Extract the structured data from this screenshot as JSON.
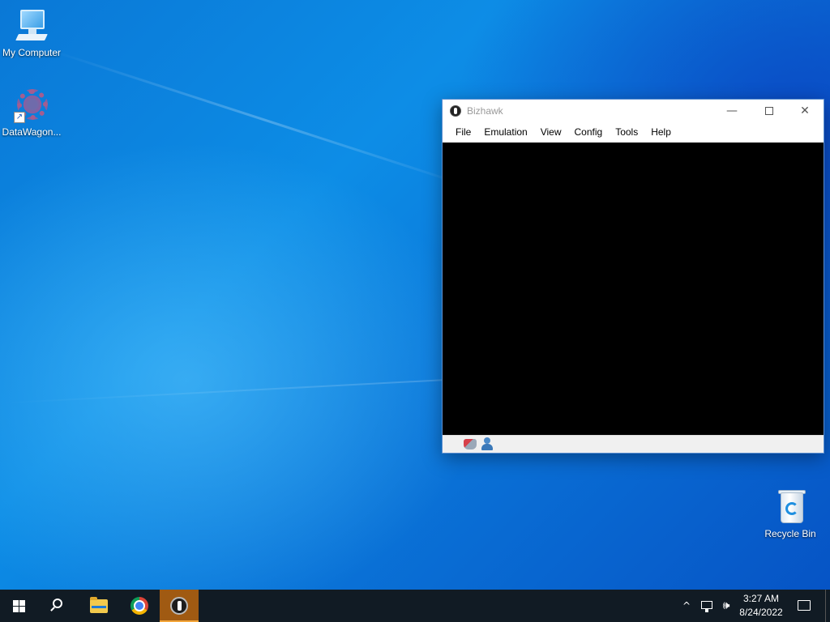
{
  "desktop": {
    "icons": [
      {
        "label": "My Computer",
        "icon": "computer-icon"
      },
      {
        "label": "DataWagon...",
        "icon": "datawagon-icon"
      },
      {
        "label": "Recycle Bin",
        "icon": "recycle-bin-icon"
      }
    ]
  },
  "window": {
    "title": "Bizhawk",
    "controls": {
      "minimize": "—",
      "close": "✕"
    },
    "menu": [
      "File",
      "Emulation",
      "View",
      "Config",
      "Tools",
      "Help"
    ],
    "status_icons": [
      "controller-icon",
      "user-icon"
    ],
    "colors": {
      "viewport": "#000000",
      "border": "#5b8fd1"
    }
  },
  "taskbar": {
    "apps": [
      "start-icon",
      "search-icon",
      "file-explorer-icon",
      "chrome-icon",
      "bizhawk-icon"
    ],
    "active_app": "bizhawk-icon",
    "tray": {
      "chevron": "^",
      "volume": "🕪"
    },
    "clock": {
      "time": "3:27 AM",
      "date": "8/24/2022"
    },
    "colors": {
      "background": "#111b24",
      "active_indicator": "#f4a63b"
    }
  }
}
